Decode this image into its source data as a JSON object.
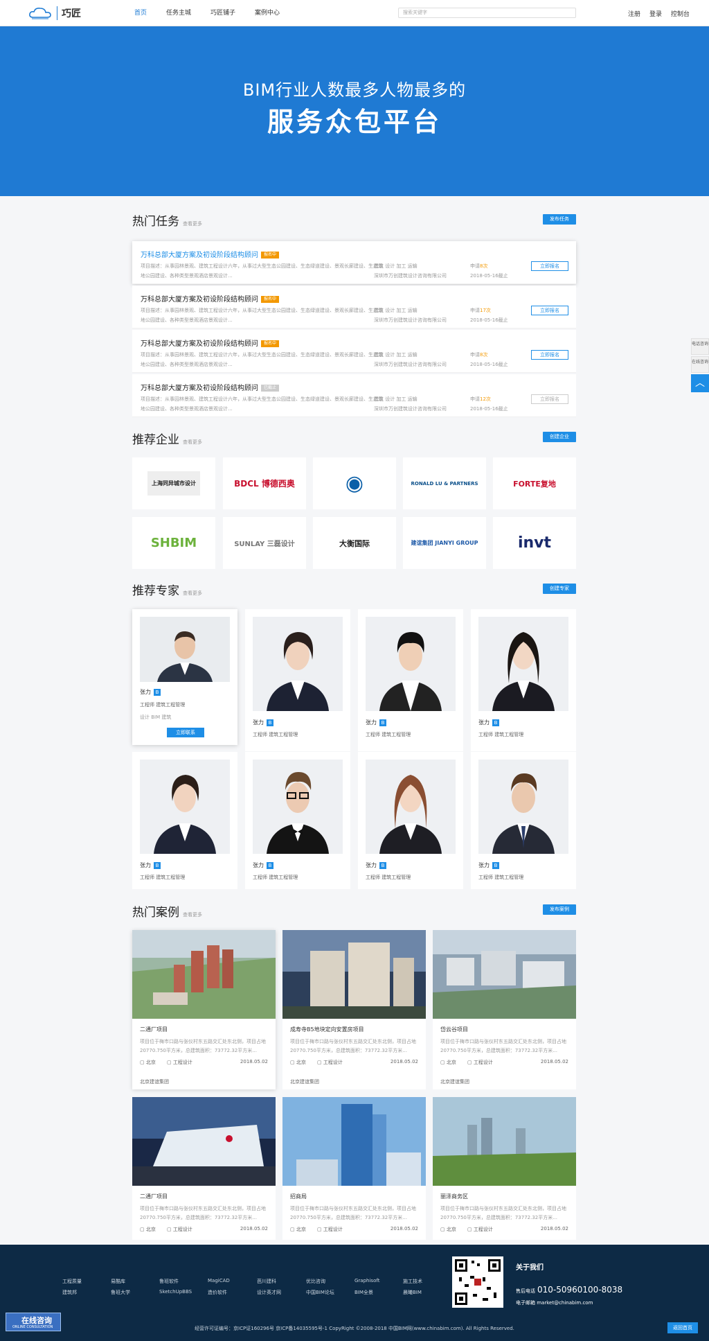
{
  "header": {
    "logo_text": "巧匠",
    "nav": [
      "首页",
      "任务主城",
      "巧匠铺子",
      "案例中心"
    ],
    "search_placeholder": "搜索关键字",
    "links": [
      "注册",
      "登录",
      "控制台"
    ]
  },
  "banner": {
    "line1": "BIM行业人数最多人物最多的",
    "line2": "服务众包平台"
  },
  "hot_tasks": {
    "title": "热门任务",
    "more": "查看更多",
    "button": "发布任务",
    "items": [
      {
        "title": "万科总部大厦方案及初设阶段结构顾问",
        "tag": "报名中",
        "desc": "项目描述：从事园林景观、建筑工程设计六年，从事过大型生态公园建设、生态绿道建设、景观长廊建设、生态湿地公园建设、各种类型景观酒店景观设计...",
        "keywords": "建筑   设计   加工   运输",
        "company": "深圳市万创建筑设计咨询有限公司",
        "apply_prefix": "申请",
        "apply_count": "8次",
        "deadline": "2018-05-16截止",
        "action": "立即报名"
      },
      {
        "title": "万科总部大厦方案及初设阶段结构顾问",
        "tag": "报名中",
        "desc": "项目描述：从事园林景观、建筑工程设计六年，从事过大型生态公园建设、生态绿道建设、景观长廊建设、生态湿地公园建设、各种类型景观酒店景观设计...",
        "keywords": "建筑   设计   加工   运输",
        "company": "深圳市万创建筑设计咨询有限公司",
        "apply_prefix": "申请",
        "apply_count": "17次",
        "deadline": "2018-05-16截止",
        "action": "立即报名"
      },
      {
        "title": "万科总部大厦方案及初设阶段结构顾问",
        "tag": "报名中",
        "desc": "项目描述：从事园林景观、建筑工程设计六年，从事过大型生态公园建设、生态绿道建设、景观长廊建设、生态湿地公园建设、各种类型景观酒店景观设计...",
        "keywords": "建筑   设计   加工   运输",
        "company": "深圳市万创建筑设计咨询有限公司",
        "apply_prefix": "申请",
        "apply_count": "8次",
        "deadline": "2018-05-16截止",
        "action": "立即报名"
      },
      {
        "title": "万科总部大厦方案及初设阶段结构顾问",
        "tag": "已截止",
        "desc": "项目描述：从事园林景观、建筑工程设计六年，从事过大型生态公园建设、生态绿道建设、景观长廊建设、生态湿地公园建设、各种类型景观酒店景观设计...",
        "keywords": "建筑   设计   加工   运输",
        "company": "深圳市万创建筑设计咨询有限公司",
        "apply_prefix": "申请",
        "apply_count": "12次",
        "deadline": "2018-05-16截止",
        "action": "立即报名"
      }
    ]
  },
  "enterprises": {
    "title": "推荐企业",
    "more": "查看更多",
    "button": "创建企业",
    "items": [
      {
        "name": "上海同异城市设计",
        "color": "#222222"
      },
      {
        "name": "BDCL 博德西奥",
        "color": "#c8102e"
      },
      {
        "name": "◉",
        "color": "#0a5fa8"
      },
      {
        "name": "RONALD LU & PARTNERS",
        "color": "#0a4f8a"
      },
      {
        "name": "FORTE复地",
        "color": "#c8102e"
      },
      {
        "name": "SHBIM",
        "color": "#6cb23c"
      },
      {
        "name": "SUNLAY 三磊设计",
        "color": "#777777"
      },
      {
        "name": "大衡国际",
        "color": "#222222"
      },
      {
        "name": "建谊集团 JIANYI GROUP",
        "color": "#1e5aa8"
      },
      {
        "name": "invt",
        "color": "#1a2a6c"
      }
    ]
  },
  "experts": {
    "title": "推荐专家",
    "more": "查看更多",
    "button": "创建专家",
    "badge": "B",
    "items": [
      {
        "name": "张力",
        "role": "工程师      建筑工程管理",
        "skills": "设计   BIM   建筑",
        "contact": "立即联系"
      },
      {
        "name": "张力",
        "role": "工程师      建筑工程管理"
      },
      {
        "name": "张力",
        "role": "工程师      建筑工程管理"
      },
      {
        "name": "张力",
        "role": "工程师      建筑工程管理"
      },
      {
        "name": "张力",
        "role": "工程师      建筑工程管理"
      },
      {
        "name": "张力",
        "role": "工程师      建筑工程管理"
      },
      {
        "name": "张力",
        "role": "工程师      建筑工程管理"
      },
      {
        "name": "张力",
        "role": "工程师      建筑工程管理"
      }
    ]
  },
  "cases": {
    "title": "热门案例",
    "more": "查看更多",
    "button": "发布案例",
    "items": [
      {
        "title": "二通厂项目",
        "desc": "项目位于梅市口路与张仪村东五路交汇处东北侧，项目占地20770.750平方米，总建筑面积：73772.32平方米...",
        "city": "北京",
        "type": "工程设计",
        "date": "2018.05.02",
        "company": "北京建谊集团"
      },
      {
        "title": "成寿寺B5地块定向安置房项目",
        "desc": "项目位于梅市口路与张仪村东五路交汇处东北侧，项目占地20770.750平方米，总建筑面积：73772.32平方米...",
        "city": "北京",
        "type": "工程设计",
        "date": "2018.05.02",
        "company": "北京建谊集团"
      },
      {
        "title": "岱云谷项目",
        "desc": "项目位于梅市口路与张仪村东五路交汇处东北侧，项目占地20770.750平方米，总建筑面积：73772.32平方米...",
        "city": "北京",
        "type": "工程设计",
        "date": "2018.05.02",
        "company": "北京建谊集团"
      },
      {
        "title": "二通厂项目",
        "desc": "项目位于梅市口路与张仪村东五路交汇处东北侧，项目占地20770.750平方米，总建筑面积：73772.32平方米...",
        "city": "北京",
        "type": "工程设计",
        "date": "2018.05.02"
      },
      {
        "title": "招商局",
        "desc": "项目位于梅市口路与张仪村东五路交汇处东北侧，项目占地20770.750平方米，总建筑面积：73772.32平方米...",
        "city": "北京",
        "type": "工程设计",
        "date": "2018.05.02"
      },
      {
        "title": "丽泽商务区",
        "desc": "项目位于梅市口路与张仪村东五路交汇处东北侧，项目占地20770.750平方米，总建筑面积：73772.32平方米...",
        "city": "北京",
        "type": "工程设计",
        "date": "2018.05.02"
      }
    ]
  },
  "footer": {
    "links_row1": [
      "工程质量",
      "易酷库",
      "鲁班软件",
      "MagiCAD",
      "芭川建科",
      "优比咨询",
      "Graphisoft",
      "施工技术"
    ],
    "links_row2": [
      "建筑邦",
      "鲁班大学",
      "SketchUpBBS",
      "造价软件",
      "设计英才网",
      "中国BIM论坛",
      "BIM全景",
      "晨曦BIM"
    ],
    "about": "关于我们",
    "phone_label": "售后电话",
    "phone": "010-50960100-8038",
    "email": "电子邮箱  market@chinabim.com",
    "copyright": "经营许可证编号：京ICP证160296号 京ICP备14035595号-1 CopyRight ©2008-2018 中国BIM网(www.chinabim.com). All Rights Reserved.",
    "back_top": "返回首页"
  },
  "sidebar": {
    "phone": "电话咨询",
    "online": "在线咨询",
    "top": "︿"
  },
  "online_chat": {
    "title": "在线咨询",
    "subtitle": "ONLINE CONSULTATION"
  }
}
